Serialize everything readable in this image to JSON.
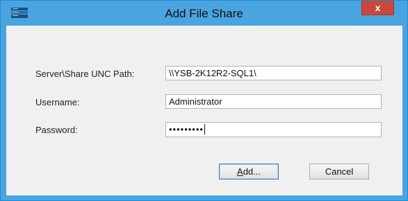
{
  "window": {
    "title": "Add File Share",
    "close_label": "x",
    "app_icon": "server-icon"
  },
  "form": {
    "unc_label": "Server\\Share UNC Path:",
    "unc_value": "\\\\YSB-2K12R2-SQL1\\",
    "username_label": "Username:",
    "username_value": "Administrator",
    "password_label": "Password:",
    "password_mask": "•••••••••"
  },
  "buttons": {
    "add_mnemonic": "A",
    "add_rest": "dd...",
    "cancel_label": "Cancel"
  },
  "colors": {
    "titlebar": "#4aa4e0",
    "close": "#c8493c",
    "client": "#f0f0f0"
  }
}
